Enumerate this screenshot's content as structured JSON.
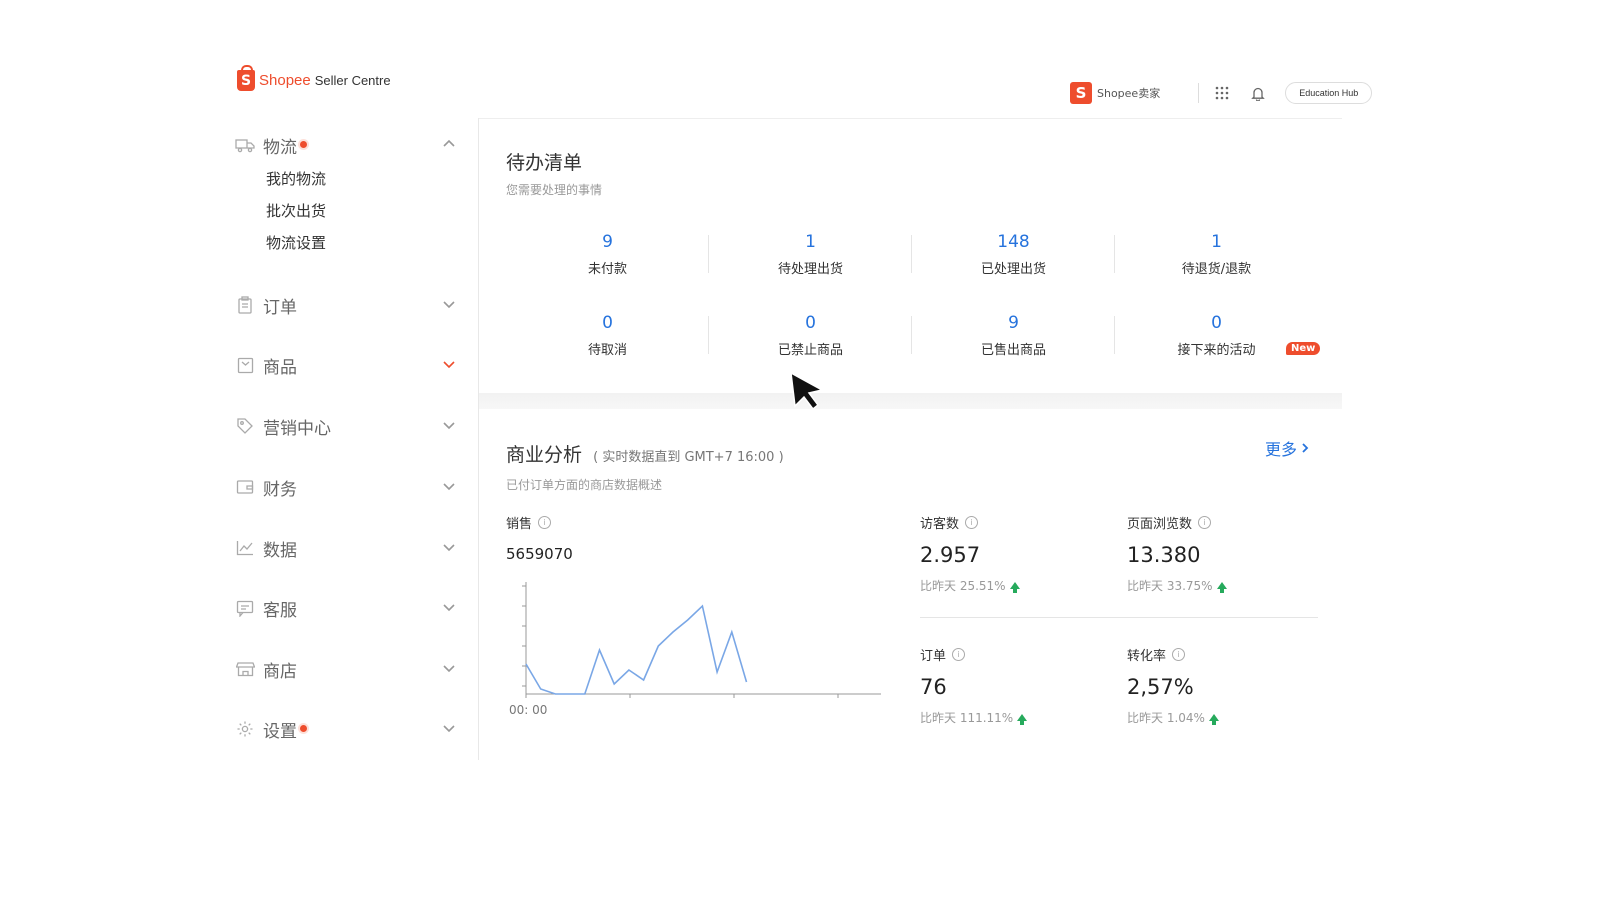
{
  "brand": {
    "name": "Shopee",
    "sub": "Seller Centre",
    "color": "#ee4d2d"
  },
  "topbar": {
    "brand_text": "Shopee卖家",
    "apps_icon": "grid-icon",
    "bell_icon": "bell-icon",
    "education_hub": "Education Hub"
  },
  "sidebar": {
    "items": [
      {
        "label": "物流",
        "icon": "truck-icon",
        "dot": true,
        "expanded": true,
        "subitems": [
          "我的物流",
          "批次出货",
          "物流设置"
        ]
      },
      {
        "label": "订单",
        "icon": "clipboard-icon"
      },
      {
        "label": "商品",
        "icon": "box-icon",
        "highlight": true
      },
      {
        "label": "营销中心",
        "icon": "tag-icon"
      },
      {
        "label": "财务",
        "icon": "wallet-icon"
      },
      {
        "label": "数据",
        "icon": "chart-icon"
      },
      {
        "label": "客服",
        "icon": "chat-icon"
      },
      {
        "label": "商店",
        "icon": "store-icon"
      },
      {
        "label": "设置",
        "icon": "gear-icon",
        "dot": true
      }
    ]
  },
  "todo": {
    "title": "待办清单",
    "desc": "您需要处理的事情",
    "items": [
      {
        "value": "9",
        "label": "未付款"
      },
      {
        "value": "1",
        "label": "待处理出货"
      },
      {
        "value": "148",
        "label": "已处理出货"
      },
      {
        "value": "1",
        "label": "待退货/退款"
      },
      {
        "value": "0",
        "label": "待取消"
      },
      {
        "value": "0",
        "label": "已禁止商品"
      },
      {
        "value": "9",
        "label": "已售出商品"
      },
      {
        "value": "0",
        "label": "接下来的活动"
      }
    ],
    "new_badge": "New",
    "accent": "#2673dd"
  },
  "business": {
    "title": "商业分析",
    "note": "( 实时数据直到 GMT+7 16:00 )",
    "desc": "已付订单方面的商店数据概述",
    "more": "更多",
    "sales": {
      "label": "销售",
      "value": "5659070",
      "axis_label": "00: 00"
    },
    "metrics": [
      {
        "label": "访客数",
        "value": "2.957",
        "cmp": "比昨天 25.51%"
      },
      {
        "label": "页面浏览数",
        "value": "13.380",
        "cmp": "比昨天 33.75%"
      },
      {
        "label": "订单",
        "value": "76",
        "cmp": "比昨天 111.11%"
      },
      {
        "label": "转化率",
        "value": "2,57%",
        "cmp": "比昨天 1.04%"
      }
    ],
    "up_color": "#26aa5c"
  },
  "chart_data": {
    "type": "line",
    "x": [
      0,
      1,
      2,
      3,
      4,
      5,
      6,
      7,
      8,
      9,
      10,
      11,
      12,
      13,
      14,
      15,
      16
    ],
    "values": [
      0.3,
      0.05,
      0,
      0,
      0,
      0.44,
      0.1,
      0.24,
      0.14,
      0.48,
      0.62,
      0.74,
      0.88,
      0.22,
      0.62,
      0.12
    ],
    "series_color": "#7aa7e6",
    "xlabel": "",
    "ylabel": "",
    "grid": false
  }
}
